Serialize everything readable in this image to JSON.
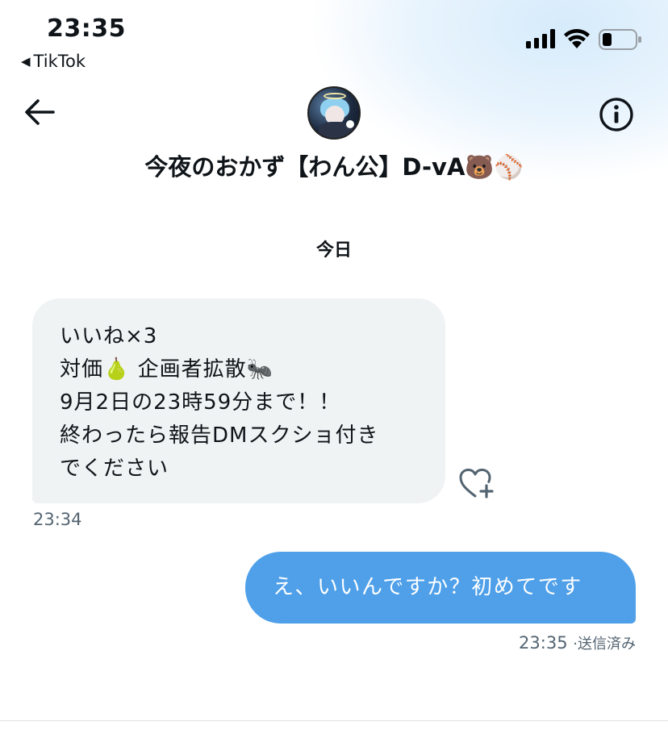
{
  "status_bar": {
    "time": "23:35",
    "back_app": "TikTok",
    "back_app_marker": "◀"
  },
  "header": {
    "display_name": "今夜のおかず【わん公】D-vA🐻⚾️",
    "icons": [
      "back-arrow-icon",
      "info-icon"
    ]
  },
  "conversation": {
    "date_separator": "今日",
    "messages": [
      {
        "direction": "incoming",
        "lines": [
          "いいね×3",
          "対価🍐 企画者拡散🐜",
          "9月2日の23時59分まで！！",
          "終わったら報告DMスクショ付き",
          "でください"
        ],
        "timestamp": "23:34"
      },
      {
        "direction": "outgoing",
        "text": "え、いいんですか？初めてです",
        "timestamp": "23:35",
        "status": "·送信済み"
      }
    ]
  },
  "colors": {
    "incoming_bubble": "#eff3f4",
    "outgoing_bubble": "#4fa0e9",
    "muted_text": "#536471"
  }
}
